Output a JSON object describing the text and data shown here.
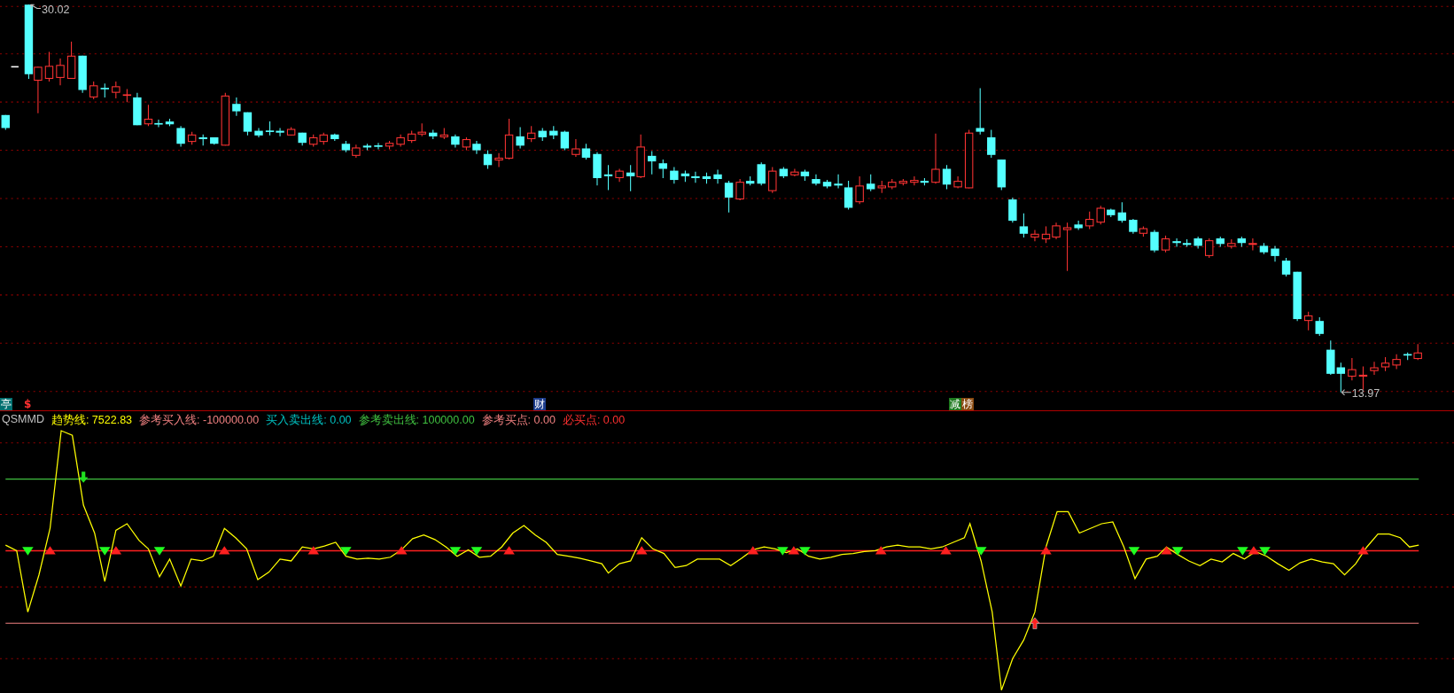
{
  "main_chart": {
    "high_label": "30.02",
    "low_label": "13.97"
  },
  "event_strip": {
    "events": [
      {
        "label": "亭",
        "kind": "badge",
        "color": "#007070"
      },
      {
        "label": "$",
        "kind": "text",
        "color": "#ff3030"
      },
      {
        "label": "财",
        "kind": "badge",
        "color": "#1c3c8c"
      },
      {
        "label": "减",
        "kind": "badge",
        "color": "#1e7a1e"
      },
      {
        "label": "榜",
        "kind": "badge",
        "color": "#8a4a10"
      }
    ]
  },
  "indicator": {
    "name": "QSMMD",
    "values": [
      {
        "label": "趋势线: 7522.83",
        "color": "#ffff00"
      },
      {
        "label": "参考买入线: -100000.00",
        "color": "#f08080"
      },
      {
        "label": "买入卖出线: 0.00",
        "color": "#00c0c0"
      },
      {
        "label": "参考卖出线: 100000.00",
        "color": "#40c040"
      },
      {
        "label": "参考买点: 0.00",
        "color": "#f08080"
      },
      {
        "label": "必买点: 0.00",
        "color": "#ff3030"
      }
    ]
  }
}
